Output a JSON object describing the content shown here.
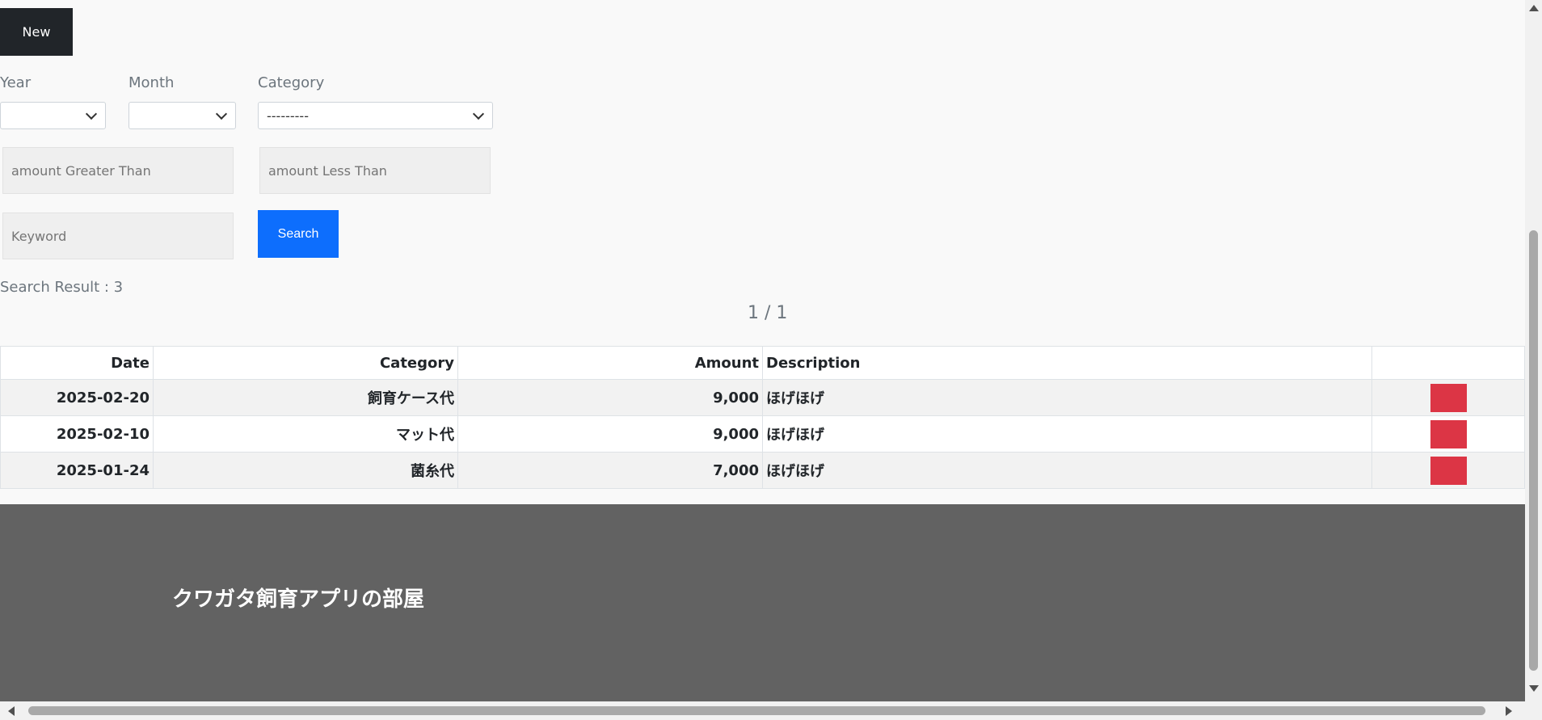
{
  "toolbar": {
    "new_label": "New"
  },
  "filters": {
    "year_label": "Year",
    "month_label": "Month",
    "category_label": "Category",
    "year_value": "",
    "month_value": "",
    "category_value": "---------",
    "amount_gt_placeholder": "amount Greater Than",
    "amount_lt_placeholder": "amount Less Than",
    "keyword_placeholder": "Keyword",
    "search_label": "Search"
  },
  "results": {
    "summary": "Search Result : 3",
    "pagination": "1 / 1"
  },
  "table": {
    "headers": {
      "date": "Date",
      "category": "Category",
      "amount": "Amount",
      "description": "Description"
    },
    "rows": [
      {
        "date": "2025-02-20",
        "category": "飼育ケース代",
        "amount": "9,000",
        "description": "ほげほげ"
      },
      {
        "date": "2025-02-10",
        "category": "マット代",
        "amount": "9,000",
        "description": "ほげほげ"
      },
      {
        "date": "2025-01-24",
        "category": "菌糸代",
        "amount": "7,000",
        "description": "ほげほげ"
      }
    ]
  },
  "footer": {
    "title": "クワガタ飼育アプリの部屋"
  },
  "colors": {
    "primary": "#0d6efd",
    "danger": "#dc3545",
    "dark": "#212529",
    "footer_bg": "#626262"
  }
}
